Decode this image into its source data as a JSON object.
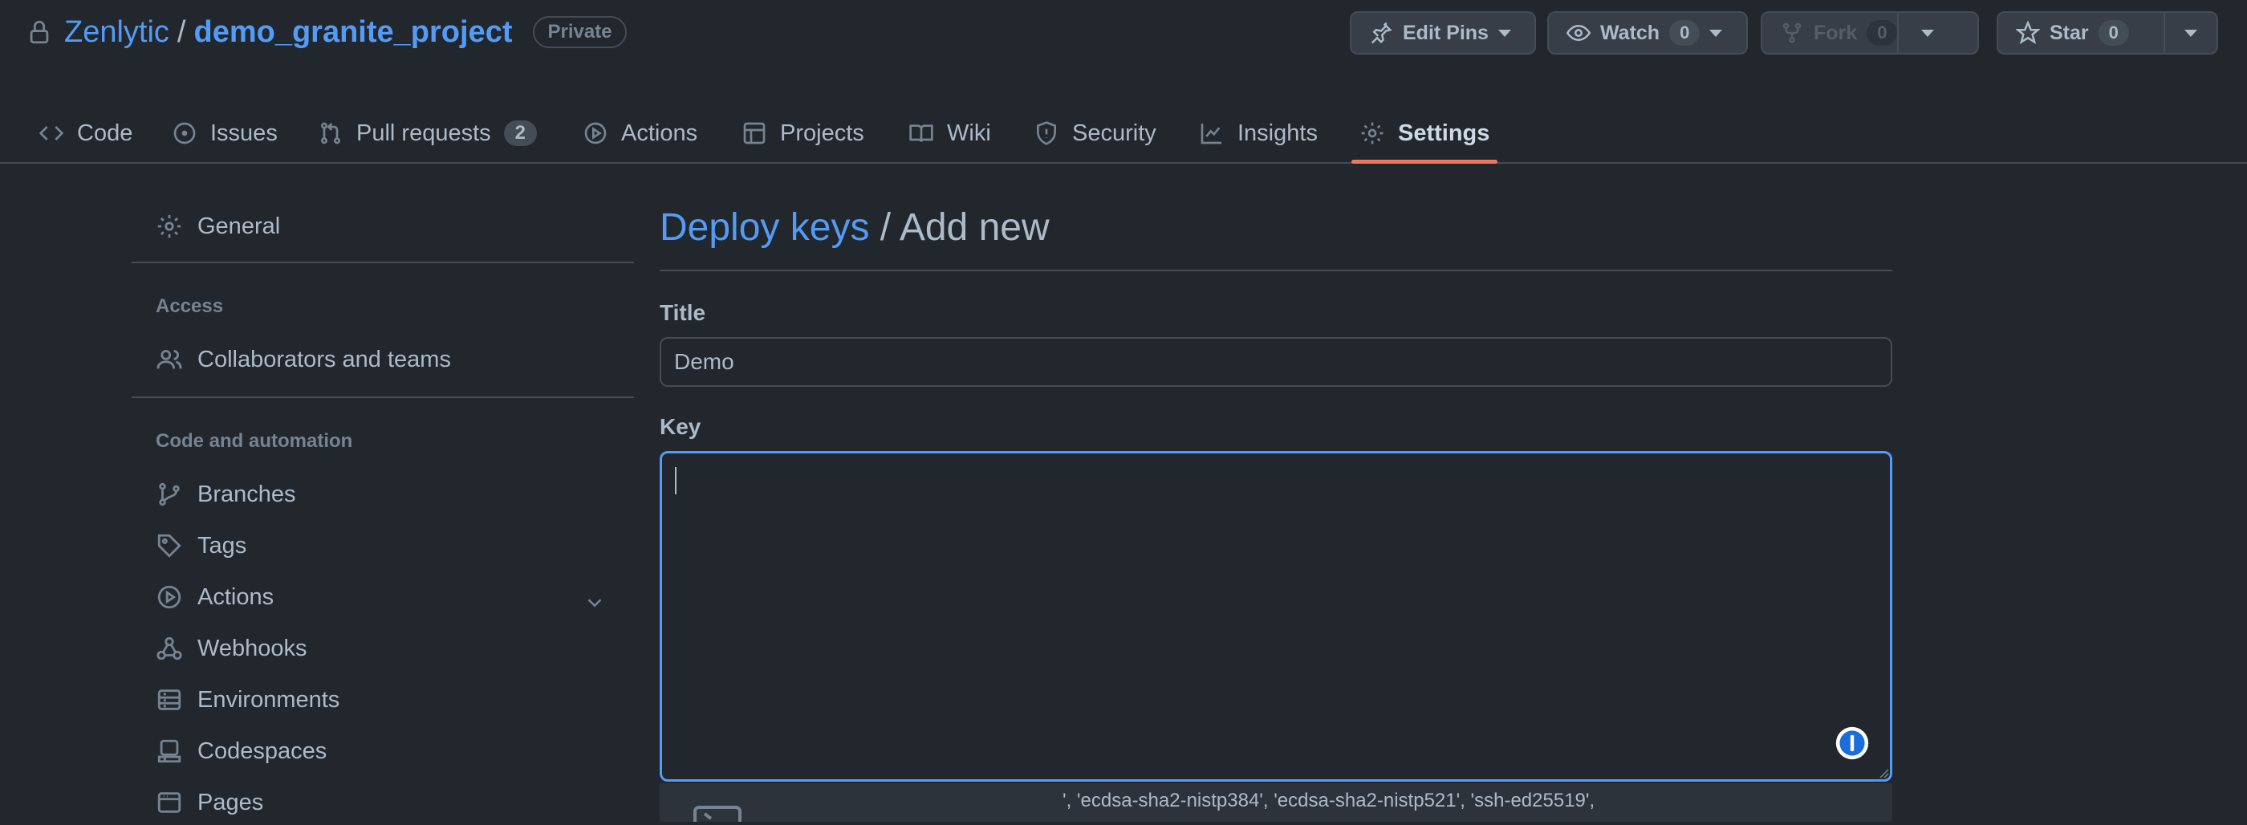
{
  "repo": {
    "owner": "Zenlytic",
    "separator": "/",
    "name": "demo_granite_project",
    "visibility": "Private"
  },
  "header_buttons": {
    "edit_pins": "Edit Pins",
    "watch": {
      "label": "Watch",
      "count": "0"
    },
    "fork": {
      "label": "Fork",
      "count": "0"
    },
    "star": {
      "label": "Star",
      "count": "0"
    }
  },
  "tabs": [
    {
      "label": "Code",
      "icon": "code-icon"
    },
    {
      "label": "Issues",
      "icon": "issue-icon"
    },
    {
      "label": "Pull requests",
      "icon": "pull-request-icon",
      "count": "2"
    },
    {
      "label": "Actions",
      "icon": "play-icon"
    },
    {
      "label": "Projects",
      "icon": "table-icon"
    },
    {
      "label": "Wiki",
      "icon": "book-icon"
    },
    {
      "label": "Security",
      "icon": "shield-icon"
    },
    {
      "label": "Insights",
      "icon": "graph-icon"
    },
    {
      "label": "Settings",
      "icon": "gear-icon",
      "selected": true
    }
  ],
  "sidebar": {
    "general": "General",
    "access_heading": "Access",
    "access_items": [
      {
        "label": "Collaborators and teams",
        "icon": "people-icon"
      }
    ],
    "code_heading": "Code and automation",
    "code_items": [
      {
        "label": "Branches",
        "icon": "branch-icon"
      },
      {
        "label": "Tags",
        "icon": "tag-icon"
      },
      {
        "label": "Actions",
        "icon": "play-icon"
      },
      {
        "label": "Webhooks",
        "icon": "webhook-icon"
      },
      {
        "label": "Environments",
        "icon": "server-icon"
      },
      {
        "label": "Codespaces",
        "icon": "codespaces-icon"
      },
      {
        "label": "Pages",
        "icon": "browser-icon"
      }
    ]
  },
  "main": {
    "breadcrumb_link": "Deploy keys",
    "breadcrumb_current": "/ Add new",
    "title_label": "Title",
    "title_value": "Demo",
    "key_label": "Key",
    "key_value": "",
    "hint_text": "', 'ecdsa-sha2-nistp384', 'ecdsa-sha2-nistp521', 'ssh-ed25519',"
  },
  "colors": {
    "background": "#22272e",
    "accent_link": "#539bf5",
    "selected_tab_underline": "#ec775c",
    "border": "#444c56"
  }
}
